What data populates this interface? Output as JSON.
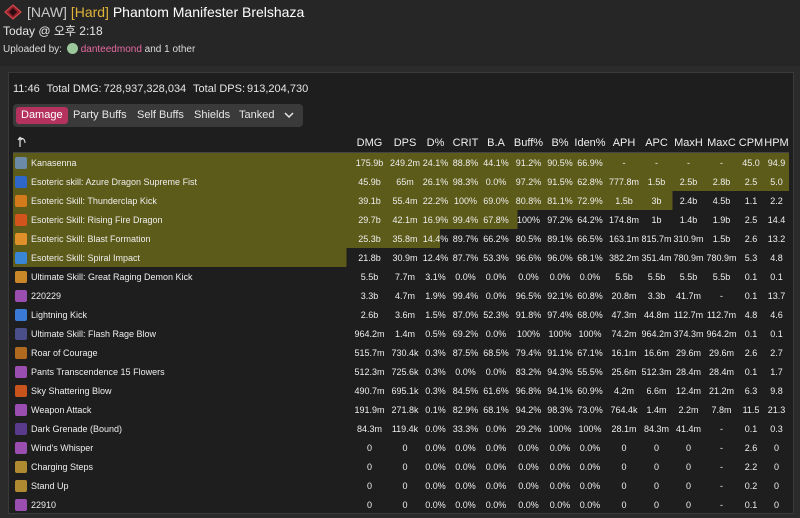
{
  "header": {
    "tag": "[NAW]",
    "difficulty": "[Hard]",
    "boss": "Phantom Manifester Brelshaza",
    "when": "Today @ 오후 2:18",
    "uploaded_by_label": "Uploaded by:",
    "uploader": "danteedmond",
    "others": "and 1 other"
  },
  "summary": {
    "duration": "11:46",
    "total_dmg_label": "Total DMG:",
    "total_dmg": "728,937,328,034",
    "total_dps_label": "Total DPS:",
    "total_dps": "913,204,730"
  },
  "tabs": [
    "Damage",
    "Party Buffs",
    "Self Buffs",
    "Shields",
    "Tanked"
  ],
  "columns": [
    "DMG",
    "DPS",
    "D%",
    "CRIT",
    "B.A",
    "Buff%",
    "B%",
    "Iden%",
    "APH",
    "APC",
    "MaxH",
    "MaxC",
    "CPM",
    "HPM"
  ],
  "rows": [
    {
      "name": "Kanasenna",
      "icon": "#6b8aa8",
      "bar": 100,
      "cells": [
        "175.9b",
        "249.2m",
        "24.1%",
        "88.8%",
        "44.1%",
        "91.2%",
        "90.5%",
        "66.9%",
        "-",
        "-",
        "-",
        "-",
        "45.0",
        "94.9"
      ]
    },
    {
      "name": "Esoteric skill: Azure Dragon Supreme Fist",
      "icon": "#2f67c9",
      "bar": 100,
      "cells": [
        "45.9b",
        "65m",
        "26.1%",
        "98.3%",
        "0.0%",
        "97.2%",
        "91.5%",
        "62.8%",
        "777.8m",
        "1.5b",
        "2.5b",
        "2.8b",
        "2.5",
        "5.0"
      ]
    },
    {
      "name": "Esoteric Skill: Thunderclap Kick",
      "icon": "#d27a1c",
      "bar": 85,
      "cells": [
        "39.1b",
        "55.4m",
        "22.2%",
        "100%",
        "69.0%",
        "80.8%",
        "81.1%",
        "72.9%",
        "1.5b",
        "3b",
        "2.4b",
        "4.5b",
        "1.1",
        "2.2"
      ]
    },
    {
      "name": "Esoteric Skill: Rising Fire Dragon",
      "icon": "#d2531c",
      "bar": 65,
      "cells": [
        "29.7b",
        "42.1m",
        "16.9%",
        "99.4%",
        "67.8%",
        "100%",
        "97.2%",
        "64.2%",
        "174.8m",
        "1b",
        "1.4b",
        "1.9b",
        "2.5",
        "14.4"
      ]
    },
    {
      "name": "Esoteric Skill: Blast Formation",
      "icon": "#e0902a",
      "bar": 55,
      "cells": [
        "25.3b",
        "35.8m",
        "14.4%",
        "89.7%",
        "66.2%",
        "80.5%",
        "89.1%",
        "66.5%",
        "163.1m",
        "815.7m",
        "310.9m",
        "1.5b",
        "2.6",
        "13.2"
      ]
    },
    {
      "name": "Esoteric Skill: Spiral Impact",
      "icon": "#3a86d6",
      "bar": 43,
      "cells": [
        "21.8b",
        "30.9m",
        "12.4%",
        "87.7%",
        "53.3%",
        "96.6%",
        "96.0%",
        "68.1%",
        "382.2m",
        "351.4m",
        "780.9m",
        "780.9m",
        "5.3",
        "4.8"
      ]
    },
    {
      "name": "Ultimate Skill: Great Raging Demon Kick",
      "icon": "#c9872a",
      "bar": 0,
      "cells": [
        "5.5b",
        "7.7m",
        "3.1%",
        "0.0%",
        "0.0%",
        "0.0%",
        "0.0%",
        "0.0%",
        "5.5b",
        "5.5b",
        "5.5b",
        "5.5b",
        "0.1",
        "0.1"
      ]
    },
    {
      "name": "220229",
      "icon": "#9a4fb0",
      "bar": 0,
      "cells": [
        "3.3b",
        "4.7m",
        "1.9%",
        "99.4%",
        "0.0%",
        "96.5%",
        "92.1%",
        "60.8%",
        "20.8m",
        "3.3b",
        "41.7m",
        "-",
        "0.1",
        "13.7"
      ]
    },
    {
      "name": "Lightning Kick",
      "icon": "#3a7ad6",
      "bar": 0,
      "cells": [
        "2.6b",
        "3.6m",
        "1.5%",
        "87.0%",
        "52.3%",
        "91.8%",
        "97.4%",
        "68.0%",
        "47.3m",
        "44.8m",
        "112.7m",
        "112.7m",
        "4.8",
        "4.6"
      ]
    },
    {
      "name": "Ultimate Skill: Flash Rage Blow",
      "icon": "#4a4f8a",
      "bar": 0,
      "cells": [
        "964.2m",
        "1.4m",
        "0.5%",
        "69.2%",
        "0.0%",
        "100%",
        "100%",
        "100%",
        "74.2m",
        "964.2m",
        "374.3m",
        "964.2m",
        "0.1",
        "0.1"
      ]
    },
    {
      "name": "Roar of Courage",
      "icon": "#b06a20",
      "bar": 0,
      "cells": [
        "515.7m",
        "730.4k",
        "0.3%",
        "87.5%",
        "68.5%",
        "79.4%",
        "91.1%",
        "67.1%",
        "16.1m",
        "16.6m",
        "29.6m",
        "29.6m",
        "2.6",
        "2.7"
      ]
    },
    {
      "name": "Pants Transcendence 15 Flowers",
      "icon": "#9a4fb0",
      "bar": 0,
      "cells": [
        "512.3m",
        "725.6k",
        "0.3%",
        "0.0%",
        "0.0%",
        "83.2%",
        "94.3%",
        "55.5%",
        "25.6m",
        "512.3m",
        "28.4m",
        "28.4m",
        "0.1",
        "1.7"
      ]
    },
    {
      "name": "Sky Shattering Blow",
      "icon": "#c9531c",
      "bar": 0,
      "cells": [
        "490.7m",
        "695.1k",
        "0.3%",
        "84.5%",
        "61.6%",
        "96.8%",
        "94.1%",
        "60.9%",
        "4.2m",
        "6.6m",
        "12.4m",
        "21.2m",
        "6.3",
        "9.8"
      ]
    },
    {
      "name": "Weapon Attack",
      "icon": "#9a4fb0",
      "bar": 0,
      "cells": [
        "191.9m",
        "271.8k",
        "0.1%",
        "82.9%",
        "68.1%",
        "94.2%",
        "98.3%",
        "73.0%",
        "764.4k",
        "1.4m",
        "2.2m",
        "7.8m",
        "11.5",
        "21.3"
      ]
    },
    {
      "name": "Dark Grenade (Bound)",
      "icon": "#5a3a8a",
      "bar": 0,
      "cells": [
        "84.3m",
        "119.4k",
        "0.0%",
        "33.3%",
        "0.0%",
        "29.2%",
        "100%",
        "100%",
        "28.1m",
        "84.3m",
        "41.4m",
        "-",
        "0.1",
        "0.3"
      ]
    },
    {
      "name": "Wind's Whisper",
      "icon": "#9a4fb0",
      "bar": 0,
      "cells": [
        "0",
        "0",
        "0.0%",
        "0.0%",
        "0.0%",
        "0.0%",
        "0.0%",
        "0.0%",
        "0",
        "0",
        "0",
        "-",
        "2.6",
        "0"
      ]
    },
    {
      "name": "Charging Steps",
      "icon": "#b08a30",
      "bar": 0,
      "cells": [
        "0",
        "0",
        "0.0%",
        "0.0%",
        "0.0%",
        "0.0%",
        "0.0%",
        "0.0%",
        "0",
        "0",
        "0",
        "-",
        "2.2",
        "0"
      ]
    },
    {
      "name": "Stand Up",
      "icon": "#b08a30",
      "bar": 0,
      "cells": [
        "0",
        "0",
        "0.0%",
        "0.0%",
        "0.0%",
        "0.0%",
        "0.0%",
        "0.0%",
        "0",
        "0",
        "0",
        "-",
        "0.2",
        "0"
      ]
    },
    {
      "name": "22910",
      "icon": "#9a4fb0",
      "bar": 0,
      "cells": [
        "0",
        "0",
        "0.0%",
        "0.0%",
        "0.0%",
        "0.0%",
        "0.0%",
        "0.0%",
        "0",
        "0",
        "0",
        "-",
        "0.1",
        "0"
      ]
    }
  ],
  "colors": {
    "accent": "#b5325f",
    "bar": "#5d5b19",
    "uploader": "#e86aa3",
    "hard": "#e0b43a"
  }
}
